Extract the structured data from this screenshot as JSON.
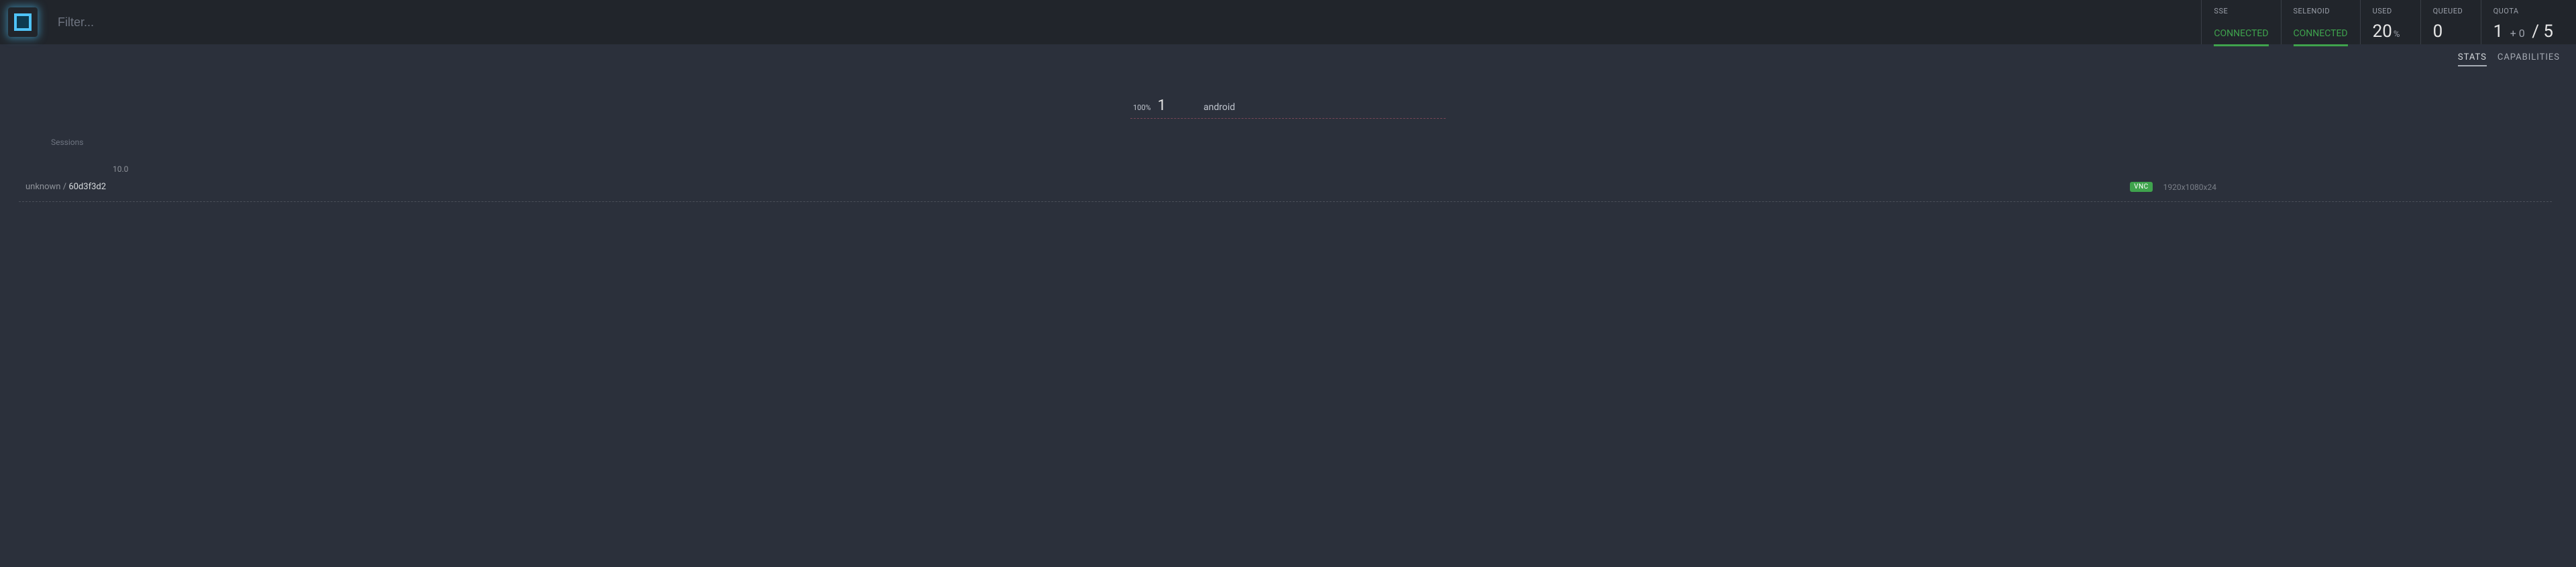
{
  "header": {
    "filter_placeholder": "Filter...",
    "status": [
      {
        "label": "SSE",
        "type": "connected",
        "value": "CONNECTED"
      },
      {
        "label": "SELENOID",
        "type": "connected",
        "value": "CONNECTED"
      },
      {
        "label": "USED",
        "type": "metric",
        "value": "20",
        "suffix": "%"
      },
      {
        "label": "QUEUED",
        "type": "metric",
        "value": "0"
      },
      {
        "label": "QUOTA",
        "type": "quota",
        "used": "1",
        "plus": "+ 0",
        "sep": "/",
        "total": "5"
      }
    ]
  },
  "tabs": {
    "stats": "STATS",
    "capabilities": "CAPABILITIES",
    "active": "stats"
  },
  "browsers": [
    {
      "percent": "100%",
      "count": "1",
      "name": "android"
    }
  ],
  "sessions": {
    "title": "Sessions",
    "version": "10.0",
    "items": [
      {
        "user": "unknown",
        "sep": " / ",
        "id": "60d3f3d2",
        "vnc": "VNC",
        "resolution": "1920x1080x24"
      }
    ]
  }
}
